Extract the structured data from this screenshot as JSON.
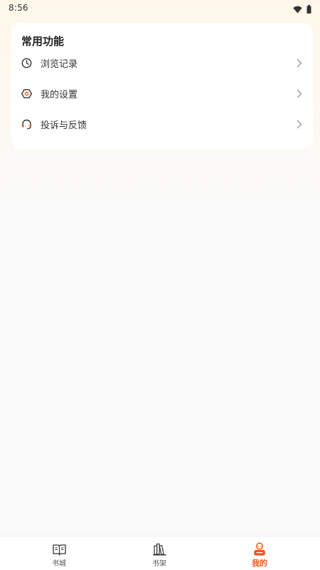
{
  "status_bar": {
    "time": "8:56",
    "icons": [
      "wifi-icon",
      "battery-icon"
    ]
  },
  "common_functions": {
    "title": "常用功能",
    "items": [
      {
        "label": "浏览记录",
        "icon": "clock-icon"
      },
      {
        "label": "我的设置",
        "icon": "settings-icon"
      },
      {
        "label": "投诉与反馈",
        "icon": "headset-icon"
      }
    ]
  },
  "tab_bar": {
    "tabs": [
      {
        "label": "书城",
        "icon": "open-book-icon",
        "active": false
      },
      {
        "label": "书架",
        "icon": "bookshelf-icon",
        "active": false
      },
      {
        "label": "我的",
        "icon": "user-icon",
        "active": true
      }
    ]
  },
  "colors": {
    "accent": "#f0541e",
    "background": "#fafafa",
    "header_tint": "#fff8ea",
    "card": "#ffffff",
    "text_primary": "#222222",
    "text_secondary": "#555555",
    "chevron": "#999999"
  }
}
